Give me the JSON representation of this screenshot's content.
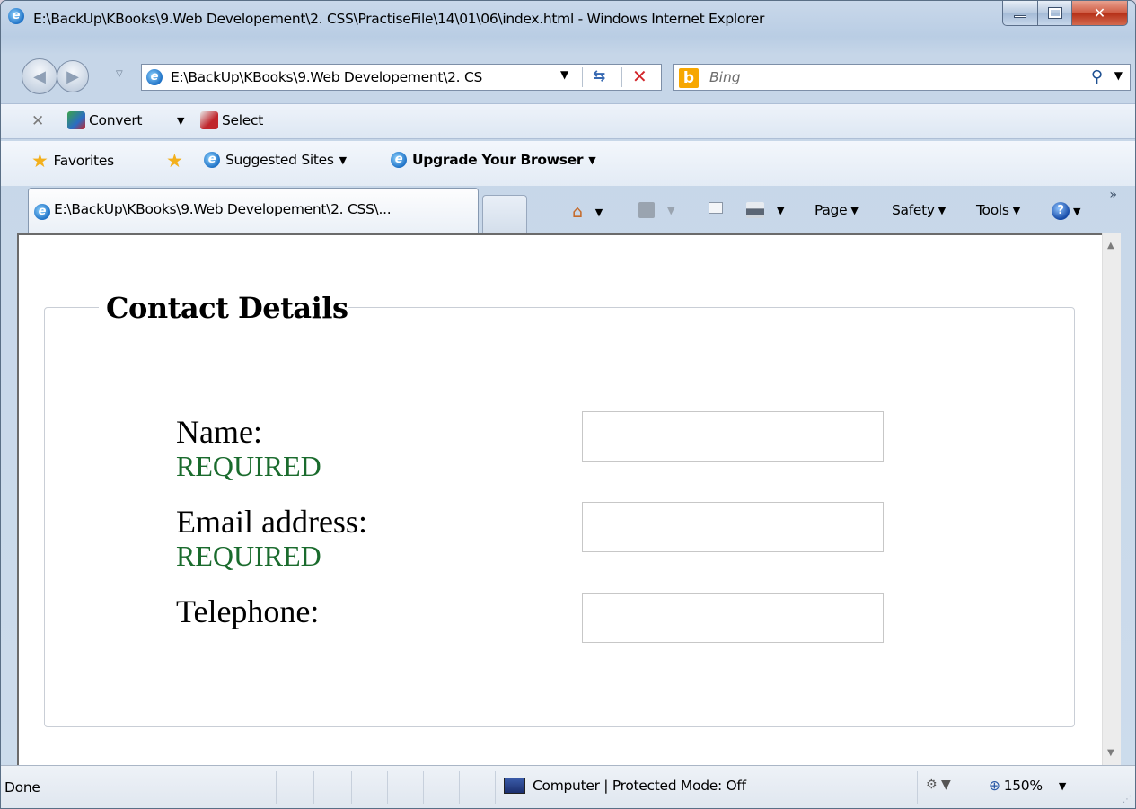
{
  "window": {
    "title": "E:\\BackUp\\KBooks\\9.Web Developement\\2. CSS\\PractiseFile\\14\\01\\06\\index.html - Windows Internet Explorer"
  },
  "address_bar": {
    "url": "E:\\BackUp\\KBooks\\9.Web Developement\\2. CS",
    "search_placeholder": "Bing"
  },
  "command_bar": {
    "convert_label": "Convert",
    "select_label": "Select"
  },
  "favorites_bar": {
    "favorites_label": "Favorites",
    "suggested_sites_label": "Suggested Sites",
    "upgrade_label": "Upgrade Your Browser"
  },
  "tab": {
    "title": "E:\\BackUp\\KBooks\\9.Web Developement\\2. CSS\\..."
  },
  "toolbar": {
    "page_label": "Page",
    "safety_label": "Safety",
    "tools_label": "Tools"
  },
  "form": {
    "legend": "Contact Details",
    "fields": [
      {
        "label": "Name:",
        "required_text": "REQUIRED",
        "value": ""
      },
      {
        "label": "Email address:",
        "required_text": "REQUIRED",
        "value": ""
      },
      {
        "label": "Telephone:",
        "value": ""
      }
    ]
  },
  "status_bar": {
    "status_text": "Done",
    "zone_text": "Computer | Protected Mode: Off",
    "zoom": "150%"
  },
  "colors": {
    "required_text": "#1a6b2d",
    "close_button": "#c4391d",
    "bing_brand": "#f7a700"
  }
}
